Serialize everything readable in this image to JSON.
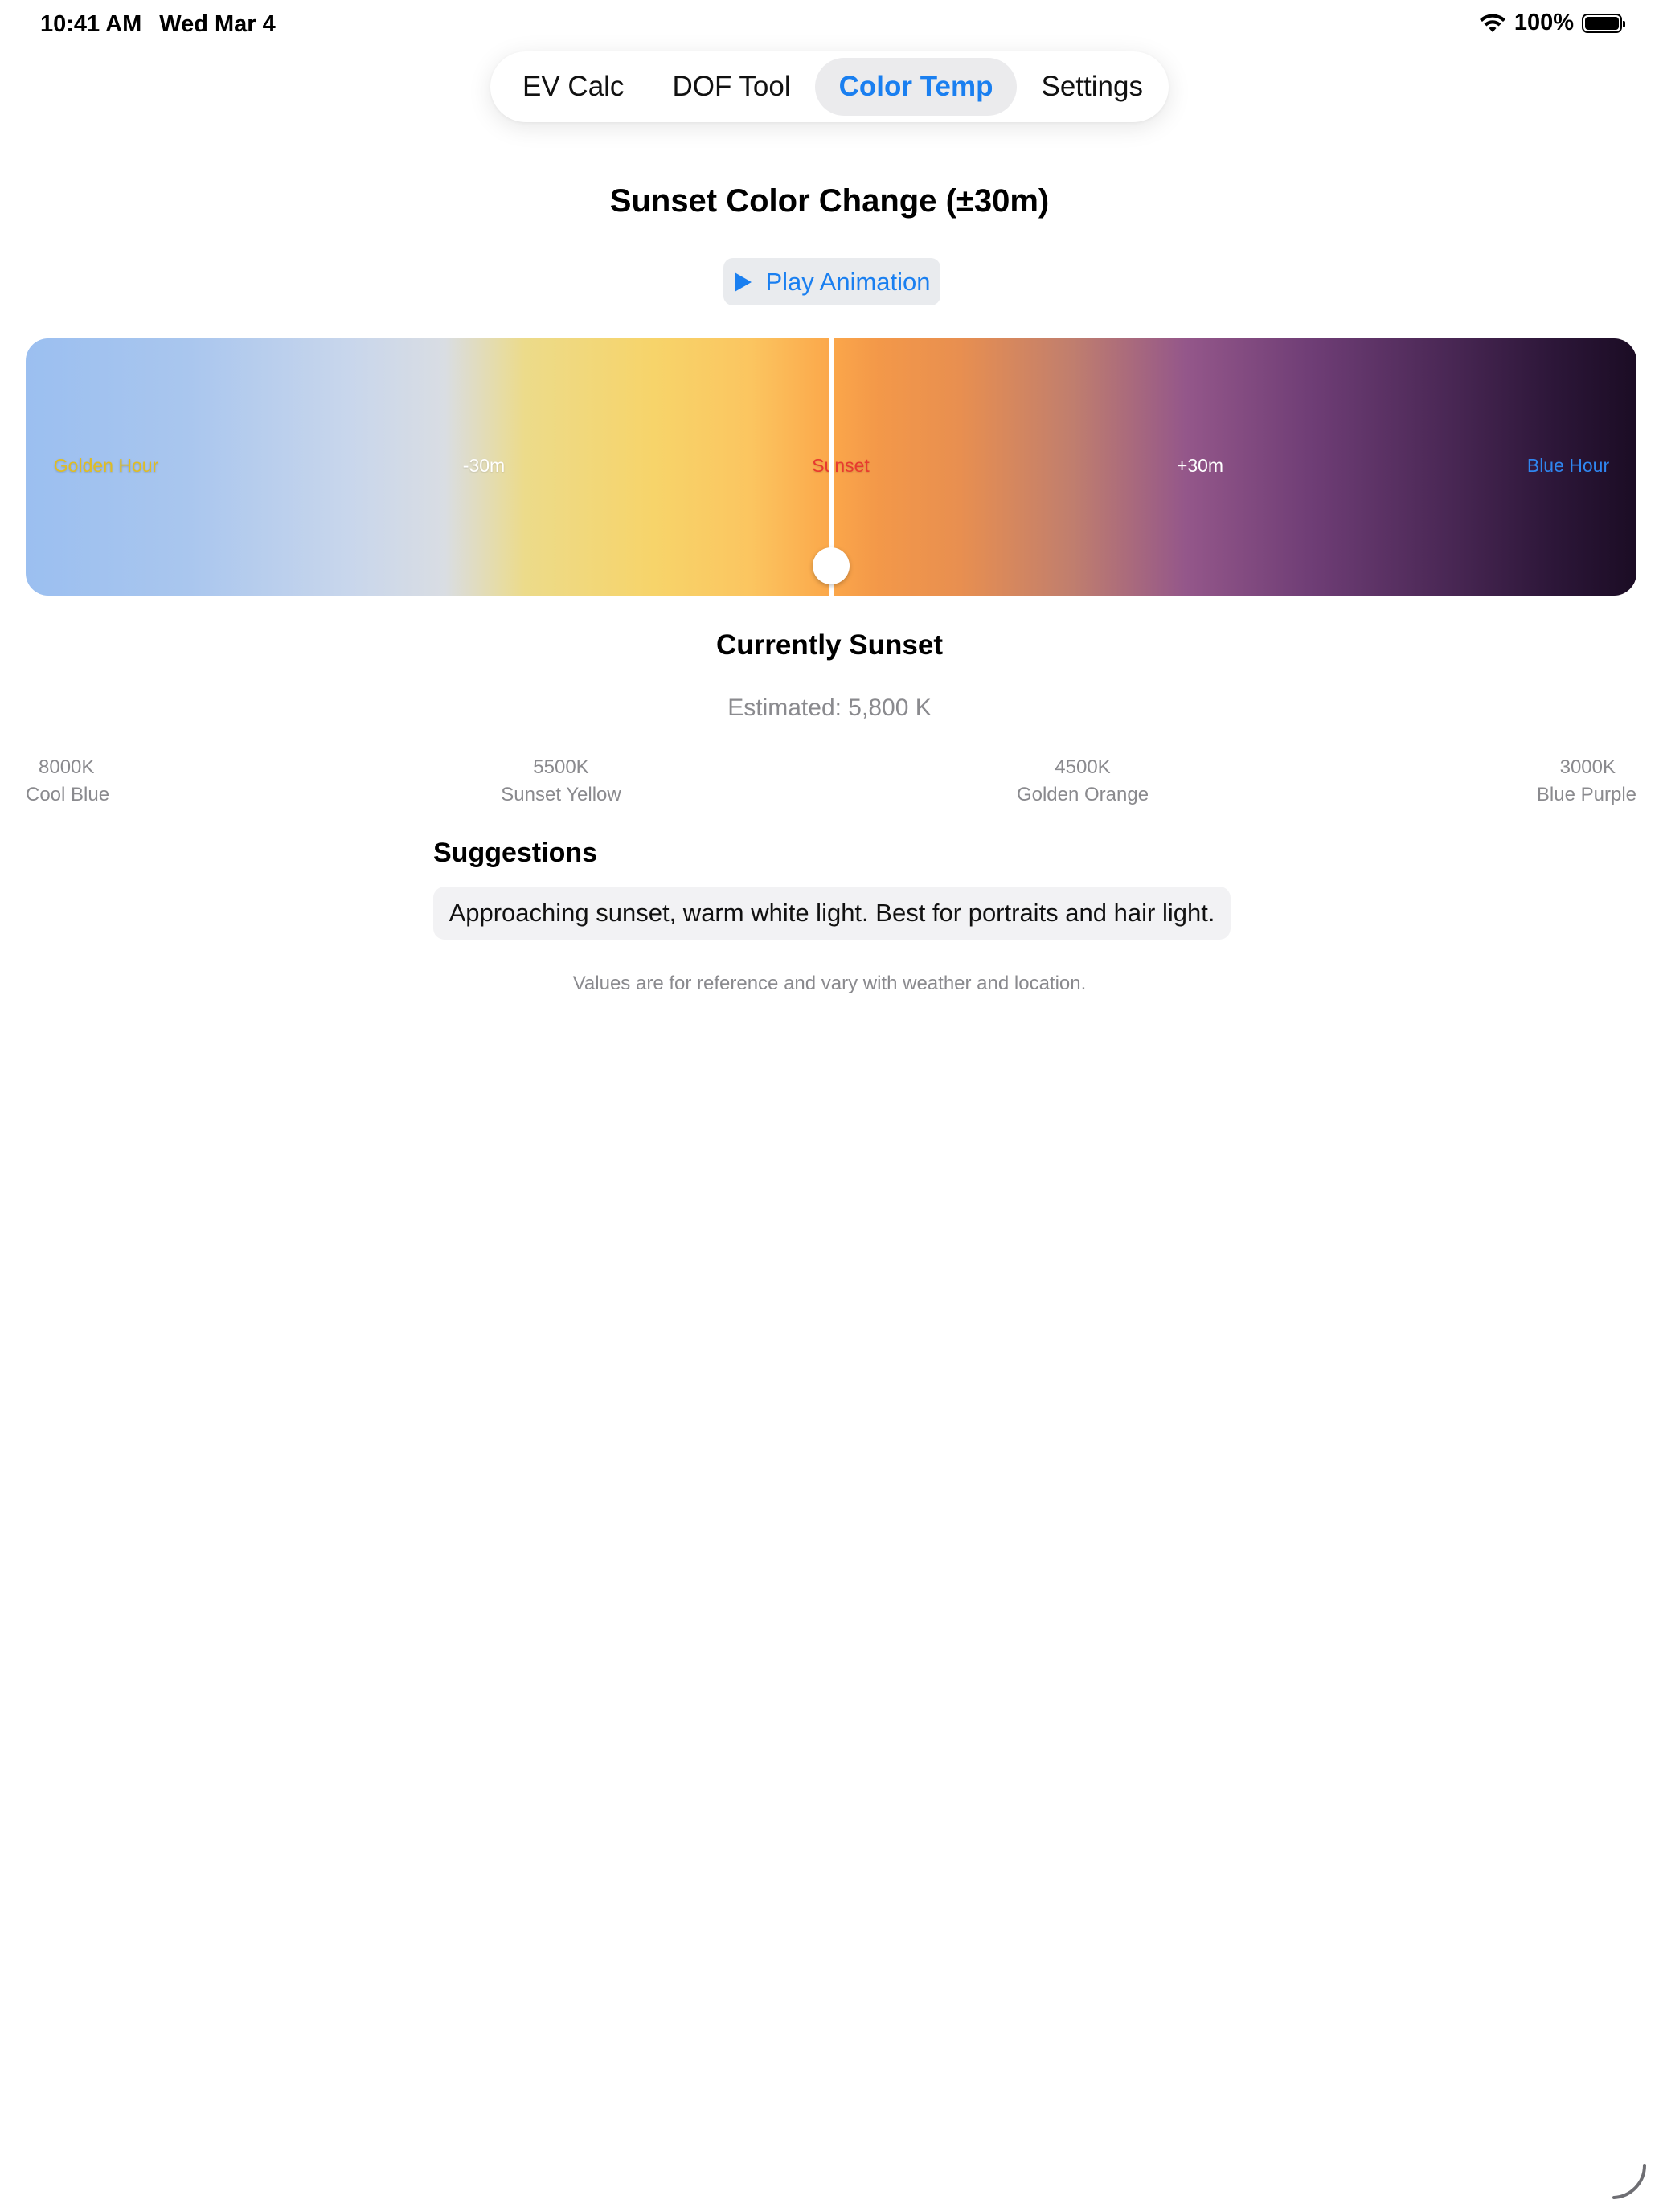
{
  "status_bar": {
    "time": "10:41 AM",
    "date": "Wed Mar 4",
    "battery": "100%",
    "icons": [
      "wifi-icon",
      "battery-icon"
    ]
  },
  "tabs": [
    {
      "label": "EV Calc",
      "active": false
    },
    {
      "label": "DOF Tool",
      "active": false
    },
    {
      "label": "Color Temp",
      "active": true
    },
    {
      "label": "Settings",
      "active": false
    }
  ],
  "page": {
    "title": "Sunset Color Change (±30m)",
    "play_label": "Play Animation"
  },
  "timeline": {
    "labels": {
      "golden_hour": "Golden Hour",
      "minus_30": "-30m",
      "sunset": "Sunset",
      "plus_30": "+30m",
      "blue_hour": "Blue Hour"
    },
    "position": 0.5
  },
  "current": {
    "phase": "Currently Sunset",
    "estimate": "Estimated: 5,800 K"
  },
  "scale": [
    {
      "kelvin": "8000K",
      "name": "Cool Blue"
    },
    {
      "kelvin": "5500K",
      "name": "Sunset Yellow"
    },
    {
      "kelvin": "4500K",
      "name": "Golden Orange"
    },
    {
      "kelvin": "3000K",
      "name": "Blue Purple"
    }
  ],
  "suggestions": {
    "heading": "Suggestions",
    "text": "Approaching sunset, warm white light. Best for portraits and hair light."
  },
  "footnote": "Values are for reference and vary with weather and location.",
  "colors": {
    "accent": "#1a7ff0",
    "active_tab_bg": "#ebebed",
    "secondary_text": "#8a8a8e",
    "golden_hour_label": "#e0bd22",
    "sunset_label": "#e8392f",
    "blue_hour_label": "#2f86f0"
  }
}
